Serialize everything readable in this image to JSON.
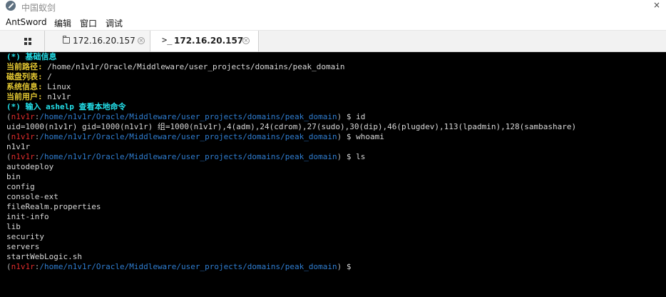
{
  "window": {
    "title": "中国蚁剑",
    "close_glyph": "×"
  },
  "menu": {
    "items": [
      "AntSword",
      "编辑",
      "窗口",
      "调试"
    ]
  },
  "tabs": [
    {
      "label": "172.16.20.157",
      "icon": "folder-icon",
      "close": "×"
    },
    {
      "label": "172.16.20.157",
      "icon": "terminal-icon",
      "close": "×",
      "active": true
    }
  ],
  "terminal": {
    "terminal_glyph": ">_",
    "info_header": "(*) 基础信息",
    "info_rows": [
      {
        "key": "当前路径:",
        "value": " /home/n1v1r/Oracle/Middleware/user_projects/domains/peak_domain"
      },
      {
        "key": "磁盘列表:",
        "value": " /"
      },
      {
        "key": "系统信息:",
        "value": " Linux"
      },
      {
        "key": "当前用户:",
        "value": " n1v1r"
      }
    ],
    "help_line": "(*) 输入 ashelp 查看本地命令",
    "prompt": {
      "open": "(",
      "user": "n1v1r",
      "sep": ":",
      "path": "/home/n1v1r/Oracle/Middleware/user_projects/domains/peak_domain",
      "close": ")",
      "dollar": " $ "
    },
    "commands": [
      {
        "cmd": "id",
        "output": [
          "uid=1000(n1v1r) gid=1000(n1v1r) 组=1000(n1v1r),4(adm),24(cdrom),27(sudo),30(dip),46(plugdev),113(lpadmin),128(sambashare)"
        ]
      },
      {
        "cmd": "whoami",
        "output": [
          "n1v1r"
        ]
      },
      {
        "cmd": "ls",
        "output": [
          "autodeploy",
          "bin",
          "config",
          "console-ext",
          "fileRealm.properties",
          "init-info",
          "lib",
          "security",
          "servers",
          "startWebLogic.sh"
        ]
      },
      {
        "cmd": "",
        "output": []
      }
    ]
  },
  "colors": {
    "cyan": "#23e0ea",
    "yellow": "#e4c832",
    "red": "#e02b2b",
    "path": "#2f7dd0",
    "background": "#000000"
  }
}
